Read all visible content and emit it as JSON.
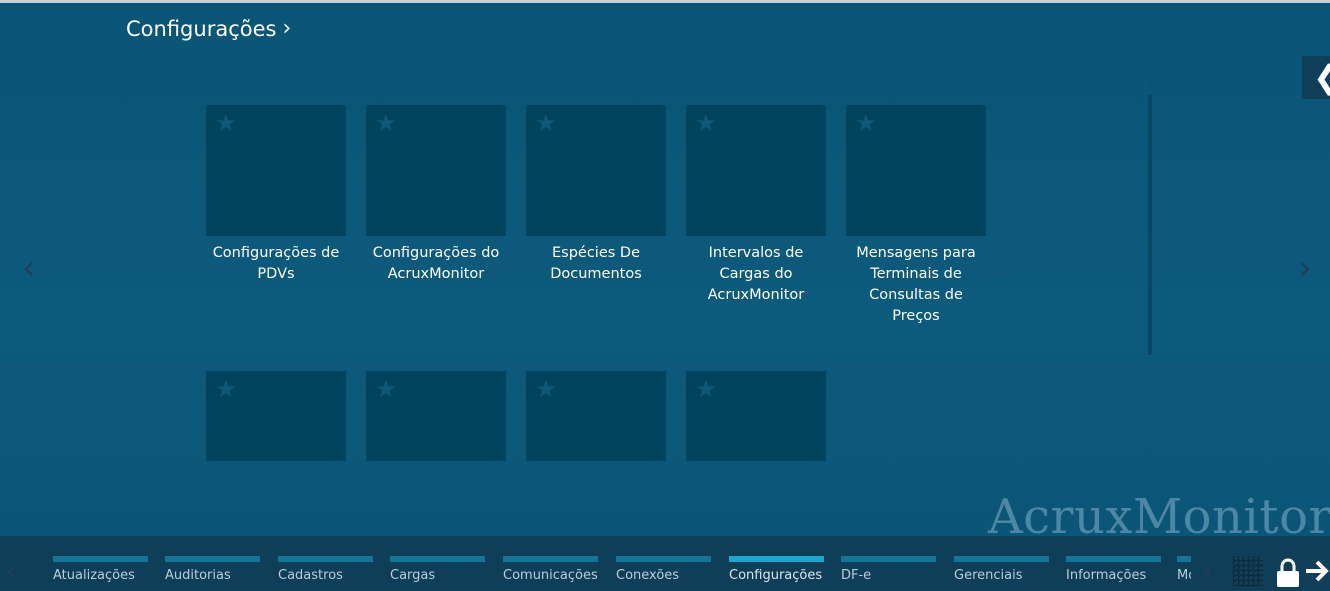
{
  "header": {
    "title": "Configurações",
    "chevron": "›"
  },
  "nav_arrows": {
    "left": "‹",
    "right": "›"
  },
  "back_tab": {
    "arrow": "❮"
  },
  "tiles": [
    {
      "label": "Configurações de PDVs",
      "icon": "star-icon"
    },
    {
      "label": "Configurações do AcruxMonitor",
      "icon": "star-icon"
    },
    {
      "label": "Espécies De Documentos",
      "icon": "star-icon"
    },
    {
      "label": "Intervalos de Cargas do AcruxMonitor",
      "icon": "star-icon"
    },
    {
      "label": "Mensagens para Terminais de Consultas de Preços",
      "icon": "star-icon"
    },
    {
      "label": "",
      "icon": "star-icon"
    },
    {
      "label": "",
      "icon": "star-icon"
    },
    {
      "label": "",
      "icon": "star-icon"
    },
    {
      "label": "",
      "icon": "star-icon"
    }
  ],
  "star_glyph": "★",
  "watermark": "AcruxMonitor",
  "bottom_nav": {
    "tabs": [
      {
        "label": "Atualizações"
      },
      {
        "label": "Auditorias"
      },
      {
        "label": "Cadastros"
      },
      {
        "label": "Cargas"
      },
      {
        "label": "Comunicações"
      },
      {
        "label": "Conexões"
      },
      {
        "label": "Configurações",
        "active": true
      },
      {
        "label": "DF-e"
      },
      {
        "label": "Gerenciais"
      },
      {
        "label": "Informações"
      },
      {
        "label": "Mo"
      }
    ],
    "icons": [
      "grid-icon",
      "lock-icon",
      "exit-icon"
    ]
  },
  "colors": {
    "background": "#0b5576",
    "tile": "#00435d",
    "bottom_bar": "#0e3e58",
    "tab_bar": "#137695",
    "tab_bar_active": "#17a9cf"
  }
}
